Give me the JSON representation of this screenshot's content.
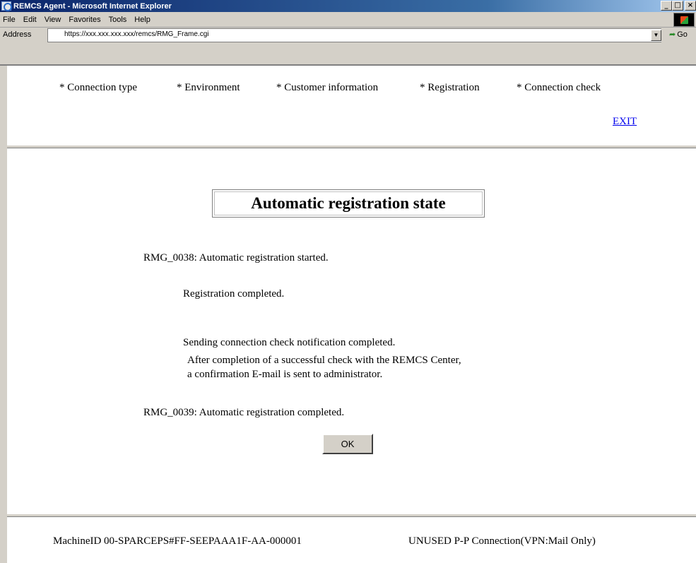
{
  "window": {
    "title": "REMCS Agent - Microsoft Internet Explorer",
    "minimize": "_",
    "maximize": "□",
    "close": "×"
  },
  "menu": {
    "items": [
      "File",
      "Edit",
      "View",
      "Favorites",
      "Tools",
      "Help"
    ]
  },
  "address": {
    "label": "Address",
    "url": "https://xxx.xxx.xxx.xxx/remcs/RMG_Frame.cgi",
    "dropdown": "▼",
    "go_label": "Go"
  },
  "nav": {
    "items": [
      "* Connection type",
      "* Environment",
      "* Customer information",
      "* Registration",
      "* Connection check"
    ],
    "exit": "EXIT"
  },
  "main": {
    "title": "Automatic registration state",
    "messages": {
      "started": "RMG_0038: Automatic registration started.",
      "registration_completed": "Registration completed.",
      "sending_completed": "Sending connection check notification completed.",
      "note_line1": "After completion of a successful check with the REMCS Center,",
      "note_line2": "a confirmation E-mail is sent to administrator.",
      "completed": "RMG_0039: Automatic registration completed."
    },
    "ok_label": "OK"
  },
  "footer": {
    "machine_id": "MachineID  00-SPARCEPS#FF-SEEPAAA1F-AA-000001",
    "connection": "UNUSED   P-P Connection(VPN:Mail Only)"
  }
}
